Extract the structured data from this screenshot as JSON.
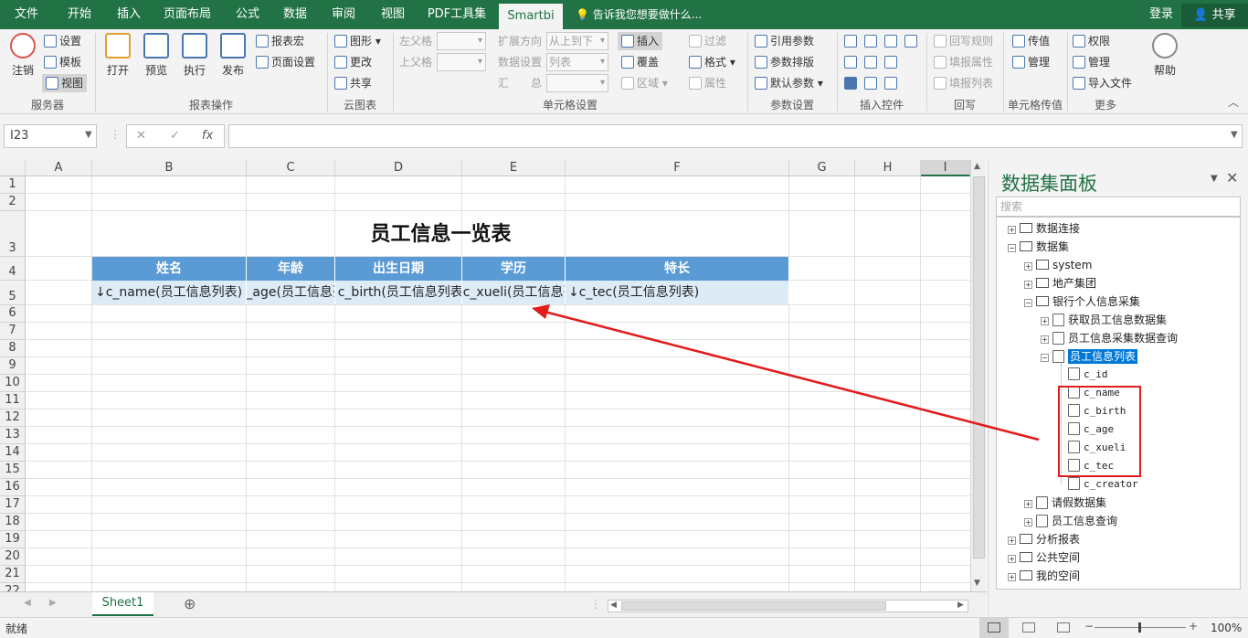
{
  "menubar": {
    "tabs": [
      "文件",
      "开始",
      "插入",
      "页面布局",
      "公式",
      "数据",
      "审阅",
      "视图",
      "PDF工具集",
      "Smartbi"
    ],
    "active": "Smartbi",
    "tell_me": "告诉我您想要做什么...",
    "login": "登录",
    "share": "共享"
  },
  "ribbon": {
    "server": {
      "logout": "注销",
      "settings": "设置",
      "template": "模板",
      "view": "视图",
      "group": "服务器"
    },
    "report_ops": {
      "open": "打开",
      "preview": "预览",
      "execute": "执行",
      "publish": "发布",
      "report_macro": "报表宏",
      "page_setup": "页面设置",
      "group": "报表操作"
    },
    "cloud": {
      "chart": "图形",
      "update": "更改",
      "share": "共享",
      "group": "云图表"
    },
    "cell_settings": {
      "left_parent": "左父格",
      "upper_parent": "上父格",
      "expand_dir": "扩展方向",
      "expand_dir_val": "从上到下",
      "data_setting": "数据设置",
      "data_setting_val": "列表",
      "summary": "汇　　总",
      "insert": "插入",
      "cover": "覆盖",
      "region": "区域",
      "filter": "过滤",
      "format": "格式",
      "property": "属性",
      "group": "单元格设置"
    },
    "params": {
      "ref": "引用参数",
      "layout": "参数排版",
      "default": "默认参数",
      "group": "参数设置"
    },
    "controls": {
      "group": "插入控件"
    },
    "writeback": {
      "rule": "回写规则",
      "fill_prop": "填报属性",
      "fill_list": "填报列表",
      "group": "回写"
    },
    "cell_pass": {
      "pass": "传值",
      "manage": "管理",
      "group": "单元格传值"
    },
    "more": {
      "perm": "权限",
      "manage": "管理",
      "import": "导入文件",
      "help": "帮助",
      "group": "更多"
    }
  },
  "formula": {
    "namebox": "I23",
    "cancel": "✕",
    "confirm": "✓",
    "fx": "fx",
    "value": ""
  },
  "grid": {
    "columns": [
      "A",
      "B",
      "C",
      "D",
      "E",
      "F",
      "G",
      "H",
      "I"
    ],
    "rows": [
      "1",
      "2",
      "3",
      "4",
      "5",
      "6",
      "7",
      "8",
      "9",
      "10",
      "11",
      "12",
      "13",
      "14",
      "15",
      "16",
      "17",
      "18",
      "19",
      "20",
      "21",
      "22"
    ],
    "title": "员工信息一览表",
    "headers": [
      "姓名",
      "年龄",
      "出生日期",
      "学历",
      "特长"
    ],
    "cells": [
      "↓c_name(员工信息列表)",
      "↓c_age(员工信息列表)",
      "↓c_birth(员工信息列表)",
      "↓c_xueli(员工信息列表)",
      "↓c_tec(员工信息列表)"
    ]
  },
  "sheet": {
    "tab": "Sheet1",
    "add": "⊕"
  },
  "status": {
    "ready": "就绪",
    "zoom": "100%"
  },
  "panel": {
    "title": "数据集面板",
    "search_placeholder": "搜索",
    "tree": [
      "数据连接",
      "数据集",
      "system",
      "地产集团",
      "银行个人信息采集",
      "获取员工信息数据集",
      "员工信息采集数据查询",
      "员工信息列表",
      "c_id",
      "c_name",
      "c_birth",
      "c_age",
      "c_xueli",
      "c_tec",
      "c_creator",
      "请假数据集",
      "员工信息查询",
      "分析报表",
      "公共空间",
      "我的空间"
    ]
  }
}
